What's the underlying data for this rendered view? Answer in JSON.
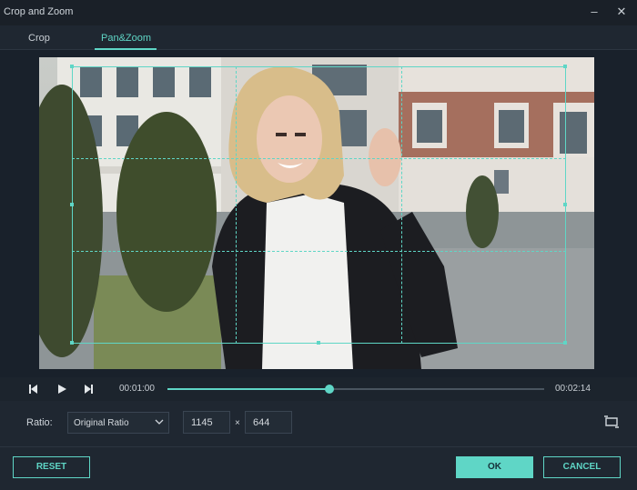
{
  "window": {
    "title": "Crop and Zoom"
  },
  "tabs": [
    {
      "label": "Crop"
    },
    {
      "label": "Pan&Zoom"
    }
  ],
  "player": {
    "current_time": "00:01:00",
    "total_time": "00:02:14",
    "progress": 0.43
  },
  "ratio": {
    "label": "Ratio:",
    "selected": "Original Ratio",
    "width": "1145",
    "separator": "×",
    "height": "644"
  },
  "buttons": {
    "reset": "RESET",
    "ok": "OK",
    "cancel": "CANCEL"
  },
  "colors": {
    "accent": "#5fd6c6",
    "background": "#1f2731"
  }
}
